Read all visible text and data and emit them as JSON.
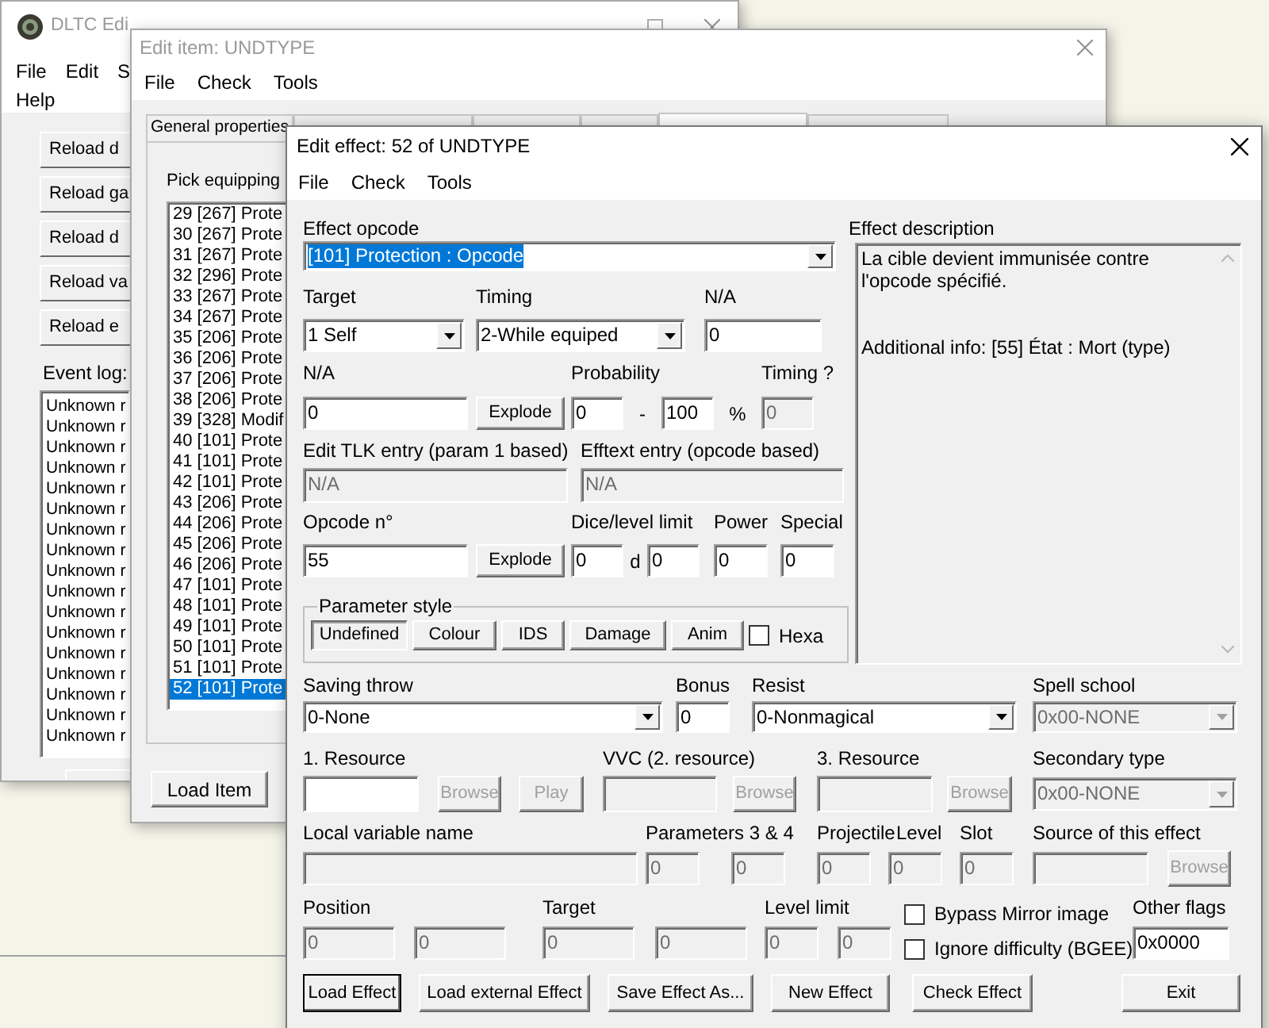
{
  "main_window": {
    "title": "DLTC Edi",
    "menu": [
      "File",
      "Edit",
      "S",
      "Help"
    ],
    "buttons": [
      "Reload d",
      "Reload ga",
      "Reload d",
      "Reload va",
      "Reload e"
    ],
    "event_log_label": "Event log:",
    "event_log": [
      "Unknown r",
      "Unknown r",
      "Unknown r",
      "Unknown r",
      "Unknown r",
      "Unknown r",
      "Unknown r",
      "Unknown r",
      "Unknown r",
      "Unknown r",
      "Unknown r",
      "Unknown r",
      "Unknown r",
      "Unknown r",
      "Unknown r",
      "Unknown r",
      "Unknown r"
    ]
  },
  "item_window": {
    "title": "Edit item: UNDTYPE",
    "menu": [
      "File",
      "Check",
      "Tools"
    ],
    "tabs": [
      {
        "label": "General properties",
        "selected": false
      },
      {
        "selected": false
      },
      {
        "selected": false
      },
      {
        "selected": false
      },
      {
        "selected": true
      },
      {
        "selected": false
      }
    ],
    "list_label": "Pick equipping",
    "effects": [
      {
        "label": "29 [267] Prote",
        "selected": false
      },
      {
        "label": "30 [267] Prote",
        "selected": false
      },
      {
        "label": "31 [267] Prote",
        "selected": false
      },
      {
        "label": "32 [296] Prote",
        "selected": false
      },
      {
        "label": "33 [267] Prote",
        "selected": false
      },
      {
        "label": "34 [267] Prote",
        "selected": false
      },
      {
        "label": "35 [206] Prote",
        "selected": false
      },
      {
        "label": "36 [206] Prote",
        "selected": false
      },
      {
        "label": "37 [206] Prote",
        "selected": false
      },
      {
        "label": "38 [206] Prote",
        "selected": false
      },
      {
        "label": "39 [328] Modif",
        "selected": false
      },
      {
        "label": "40 [101] Prote",
        "selected": false
      },
      {
        "label": "41 [101] Prote",
        "selected": false
      },
      {
        "label": "42 [101] Prote",
        "selected": false
      },
      {
        "label": "43 [206] Prote",
        "selected": false
      },
      {
        "label": "44 [206] Prote",
        "selected": false
      },
      {
        "label": "45 [206] Prote",
        "selected": false
      },
      {
        "label": "46 [206] Prote",
        "selected": false
      },
      {
        "label": "47 [101] Prote",
        "selected": false
      },
      {
        "label": "48 [101] Prote",
        "selected": false
      },
      {
        "label": "49 [101] Prote",
        "selected": false
      },
      {
        "label": "50 [101] Prote",
        "selected": false
      },
      {
        "label": "51 [101] Prote",
        "selected": false
      },
      {
        "label": "52 [101] Prote",
        "selected": true
      }
    ],
    "load_button": "Load Item"
  },
  "effect_window": {
    "title": "Edit effect: 52 of UNDTYPE",
    "menu": [
      "File",
      "Check",
      "Tools"
    ],
    "labels": {
      "effect_opcode": "Effect opcode",
      "target": "Target",
      "timing": "Timing",
      "na_1": "N/A",
      "na_2": "N/A",
      "probability": "Probability",
      "timing_q": "Timing ?",
      "tlk": "Edit TLK entry (param 1 based)",
      "efftext": "Efftext entry (opcode based)",
      "opcode_no": "Opcode n°",
      "dice": "Dice/level limit",
      "power": "Power",
      "special": "Special",
      "parameter_style": "Parameter style",
      "description": "Effect description",
      "saving_throw": "Saving throw",
      "bonus": "Bonus",
      "resist": "Resist",
      "spell_school": "Spell school",
      "resource_1": "1. Resource",
      "vvc": "VVC (2. resource)",
      "resource_3": "3. Resource",
      "secondary_type": "Secondary type",
      "local_variable": "Local variable name",
      "parameters_3_4": "Parameters 3 & 4",
      "projectile": "Projectile",
      "level": "Level",
      "slot": "Slot",
      "source": "Source of this effect",
      "position": "Position",
      "target_2": "Target",
      "level_limit": "Level limit",
      "other_flags": "Other flags"
    },
    "separators": {
      "dash": "-",
      "percent": "%",
      "dice": "d"
    },
    "controls": {
      "effect_opcode": {
        "value": "[101] Protection : Opcode",
        "disabled": false,
        "highlighted": true
      },
      "target": {
        "value": "1 Self",
        "disabled": false
      },
      "timing": {
        "value": "2-While equiped",
        "disabled": false
      },
      "na_1": {
        "value": "0",
        "disabled": false
      },
      "na_2": {
        "value": "0",
        "disabled": false
      },
      "explode_1": {
        "label": "Explode",
        "disabled": false
      },
      "probability_low": {
        "value": "0",
        "disabled": false
      },
      "probability_high": {
        "value": "100",
        "disabled": false
      },
      "timing_q": {
        "value": "0",
        "disabled": true
      },
      "tlk": {
        "value": "N/A",
        "disabled": true
      },
      "efftext": {
        "value": "N/A",
        "disabled": true
      },
      "opcode_no": {
        "value": "55",
        "disabled": false
      },
      "explode_2": {
        "label": "Explode",
        "disabled": false
      },
      "dice_count": {
        "value": "0",
        "disabled": false
      },
      "dice_sides": {
        "value": "0",
        "disabled": false
      },
      "power": {
        "value": "0",
        "disabled": false
      },
      "special": {
        "value": "0",
        "disabled": false
      },
      "saving_throw": {
        "value": "0-None",
        "disabled": false
      },
      "bonus": {
        "value": "0",
        "disabled": false
      },
      "resist": {
        "value": "0-Nonmagical",
        "disabled": false
      },
      "spell_school": {
        "value": "0x00-NONE",
        "disabled": true
      },
      "resource_1": {
        "disabled": false
      },
      "browse_1": {
        "label": "Browse",
        "disabled": true
      },
      "play": {
        "label": "Play",
        "disabled": true
      },
      "vvc": {
        "disabled": true
      },
      "browse_2": {
        "label": "Browse",
        "disabled": true
      },
      "resource_3": {
        "disabled": true
      },
      "browse_3": {
        "label": "Browse",
        "disabled": true
      },
      "secondary_type": {
        "value": "0x00-NONE",
        "disabled": true
      },
      "local_variable": {
        "disabled": true
      },
      "parameter_3": {
        "value": "0",
        "disabled": true
      },
      "parameter_4": {
        "value": "0",
        "disabled": true
      },
      "projectile": {
        "value": "0",
        "disabled": true
      },
      "level": {
        "value": "0",
        "disabled": true
      },
      "slot": {
        "value": "0",
        "disabled": true
      },
      "source": {
        "disabled": true
      },
      "browse_4": {
        "label": "Browse",
        "disabled": true
      },
      "position_1": {
        "value": "0",
        "disabled": true
      },
      "position_2": {
        "value": "0",
        "disabled": true
      },
      "target_1": {
        "value": "0",
        "disabled": true
      },
      "target_2": {
        "value": "0",
        "disabled": true
      },
      "level_limit_1": {
        "value": "0",
        "disabled": true
      },
      "level_limit_2": {
        "value": "0",
        "disabled": true
      },
      "other_flags": {
        "value": "0x0000",
        "disabled": false
      }
    },
    "parameter_style_buttons": [
      {
        "label": "Undefined",
        "selected": true
      },
      {
        "label": "Colour",
        "selected": false
      },
      {
        "label": "IDS",
        "selected": false
      },
      {
        "label": "Damage",
        "selected": false
      },
      {
        "label": "Anim",
        "selected": false
      }
    ],
    "hexa": {
      "label": "Hexa",
      "checked": false
    },
    "description": {
      "text": "La cible devient immunisée contre l'opcode spécifié.",
      "additional_info": "Additional info: [55] État : Mort (type)"
    },
    "checkboxes": [
      {
        "label": "Bypass Mirror image",
        "checked": false
      },
      {
        "label": "Ignore difficulty (BGEE)",
        "checked": false
      }
    ],
    "buttons": [
      {
        "label": "Load Effect",
        "default": true
      },
      {
        "label": "Load external Effect",
        "default": false
      },
      {
        "label": "Save Effect As...",
        "default": false
      },
      {
        "label": "New Effect",
        "default": false
      },
      {
        "label": "Check Effect",
        "default": false
      },
      {
        "label": "Exit",
        "default": false
      }
    ]
  }
}
